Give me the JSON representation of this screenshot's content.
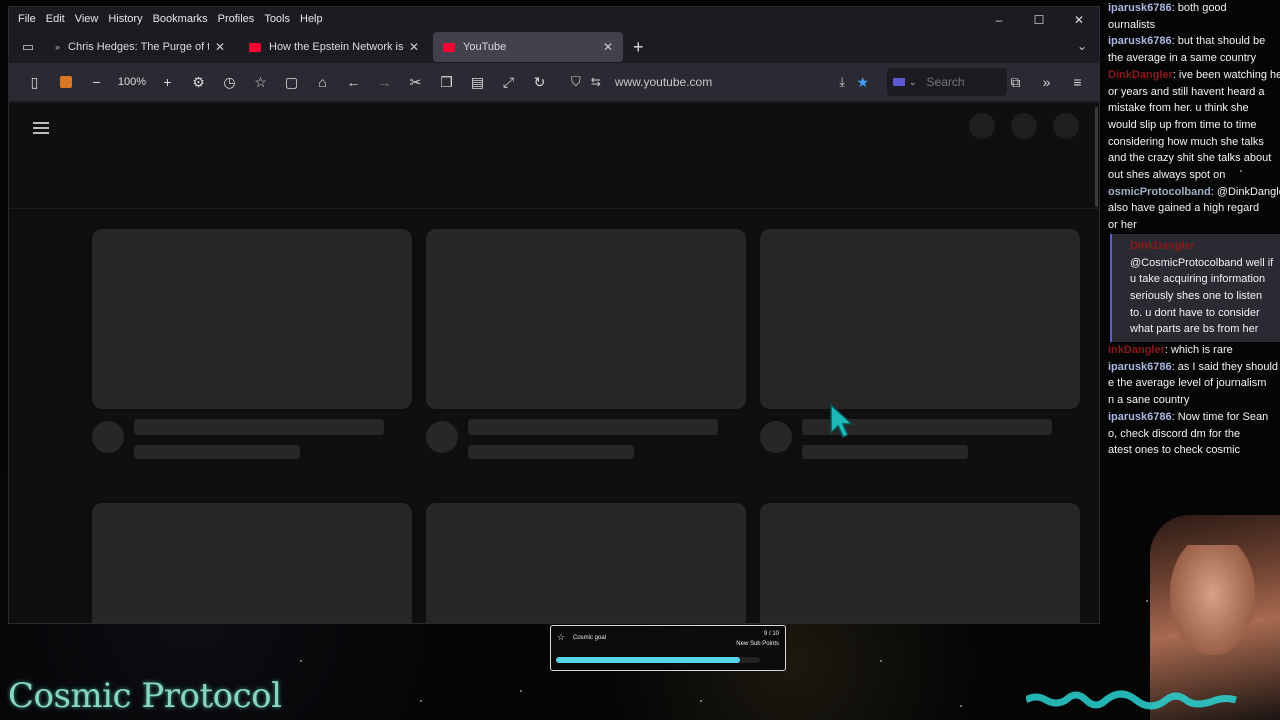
{
  "menu": [
    "File",
    "Edit",
    "View",
    "History",
    "Bookmarks",
    "Profiles",
    "Tools",
    "Help"
  ],
  "window_controls": [
    "–",
    "☐",
    "✕"
  ],
  "tabs": [
    {
      "title": "Chris Hedges: The Purge of the",
      "favicon_color": "#aaaaaa",
      "active": false
    },
    {
      "title": "How the Epstein Network is Priv",
      "favicon_color": "#ff0033",
      "active": false
    },
    {
      "title": "YouTube",
      "favicon_color": "#ff0033",
      "active": true
    }
  ],
  "toolbar": {
    "zoom": "100%",
    "url": "www.youtube.com",
    "search_placeholder": "Search"
  },
  "stream": {
    "goal_label": "Cosmic goal",
    "goal_count": "9 / 10",
    "goal_subtitle": "New Sub Points",
    "goal_progress": 0.9,
    "logo_text": "Cosmic Protocol"
  },
  "chat": [
    {
      "user": "iparusk6786",
      "text": "both good"
    },
    {
      "user": "",
      "text": "ournalists"
    },
    {
      "user": "iparusk6786",
      "text": "but that should be"
    },
    {
      "user": "",
      "text": "the average in a same country"
    },
    {
      "user": "DinkDangler",
      "text": "ive been watching her"
    },
    {
      "user": "",
      "text": "or years and still havent heard a"
    },
    {
      "user": "",
      "text": "mistake from her. u think she"
    },
    {
      "user": "",
      "text": "would slip up from time to time"
    },
    {
      "user": "",
      "text": "considering how much she talks"
    },
    {
      "user": "",
      "text": "and the crazy shit she talks about"
    },
    {
      "user": "",
      "text": "out shes always spot on"
    },
    {
      "user": "osmicProtocolband",
      "text": "@DinkDangler"
    },
    {
      "user": "",
      "text": "also have gained a high regard"
    },
    {
      "user": "",
      "text": "or her"
    }
  ],
  "chat_highlight": {
    "user": "DinkDangler",
    "text": "@CosmicProtocolband well if u take acquiring information seriously shes one to listen to. u dont have to consider what parts are bs from her"
  },
  "chat_after": [
    {
      "user": "inkDangler",
      "text": "which is rare"
    },
    {
      "user": "iparusk6786",
      "text": "as I said they should"
    },
    {
      "user": "",
      "text": "e the average level of journalism"
    },
    {
      "user": "",
      "text": "n a sane country"
    },
    {
      "user": "iparusk6786",
      "text": "Now time for Sean"
    },
    {
      "user": "",
      "text": "o, check discord dm for the"
    },
    {
      "user": "",
      "text": "atest ones to check cosmic"
    }
  ]
}
